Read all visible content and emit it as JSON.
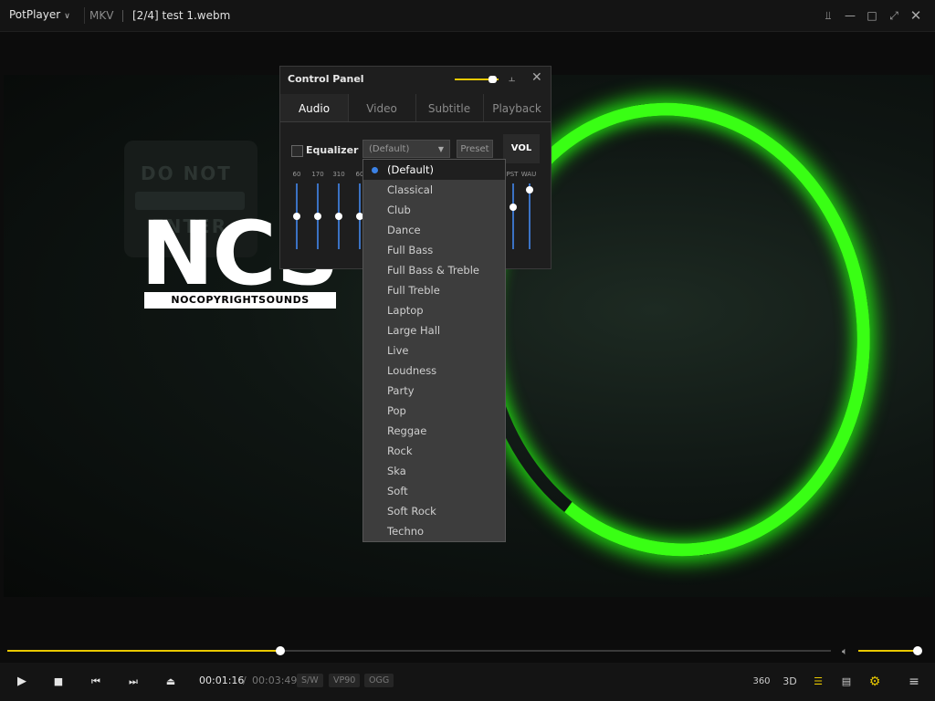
{
  "app": {
    "menu_label": "PotPlayer",
    "format": "MKV",
    "title": "[2/4] test 1.webm"
  },
  "window_buttons": [
    "pin-icon",
    "minimize-icon",
    "maximize-icon",
    "fullscreen-icon",
    "close-icon"
  ],
  "video": {
    "sign_line1": "DO NOT",
    "sign_line2": "ENTER",
    "logo_text": "NCS",
    "logo_sub": "NOCOPYRIGHTSOUNDS"
  },
  "control_panel": {
    "title": "Control Panel",
    "tabs": [
      "Audio",
      "Video",
      "Subtitle",
      "Playback"
    ],
    "active_tab": "Audio",
    "equalizer_label": "Equalizer",
    "preset_value": "(Default)",
    "preset_button": "Preset",
    "vol_button": "VOL",
    "bands": [
      "60",
      "170",
      "310",
      "60",
      "",
      "",
      "",
      "",
      "",
      "PST",
      "WAU"
    ],
    "accent": "#e8c800",
    "slider_color": "#3b72c4"
  },
  "preset_list": {
    "selected": "(Default)",
    "items": [
      "(Default)",
      "Classical",
      "Club",
      "Dance",
      "Full Bass",
      "Full Bass & Treble",
      "Full Treble",
      "Laptop",
      "Large Hall",
      "Live",
      "Loudness",
      "Party",
      "Pop",
      "Reggae",
      "Rock",
      "Ska",
      "Soft",
      "Soft Rock",
      "Techno"
    ]
  },
  "playback": {
    "time_current": "00:01:16",
    "time_separator": "/",
    "time_total": "00:03:49",
    "badges": [
      "S/W",
      "VP90",
      "OGG"
    ],
    "progress_fraction": 0.332,
    "volume_fraction": 0.95,
    "controls": [
      "play-icon",
      "stop-icon",
      "previous-icon",
      "next-icon",
      "eject-icon"
    ],
    "right_icons": [
      "360",
      "3D",
      "playlist-search-icon",
      "chapter-icon",
      "settings-icon",
      "menu-icon"
    ]
  }
}
